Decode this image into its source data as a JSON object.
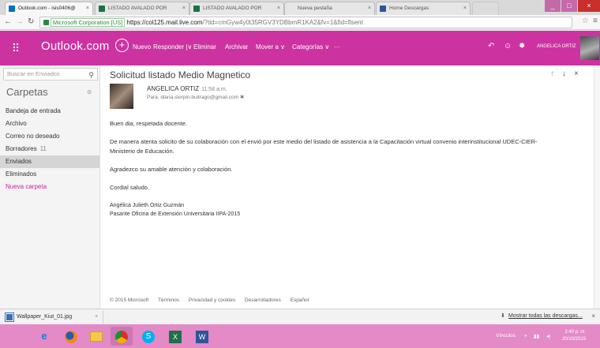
{
  "browser": {
    "tabs": [
      {
        "label": "Outlook.com - isis0406@",
        "color": "#0072c6"
      },
      {
        "label": "LISTADO AVALADO POR",
        "color": "#1e7145"
      },
      {
        "label": "LISTADO AVALADO POR",
        "color": "#1e7145"
      },
      {
        "label": "Nueva pestaña",
        "color": ""
      },
      {
        "label": "Home Descargas",
        "color": "#2b579a"
      }
    ],
    "tab_close": "×",
    "url_org": "Microsoft Corporation [US]",
    "url_host": "https://col125.mail.live.com",
    "url_path": "/?tid=cmGyw4y0t35RGV3YDBbmR1KA2&fv=1&fid=flsent",
    "win_min": "_",
    "win_max": "□",
    "win_close": "×"
  },
  "outlook": {
    "brand": "Outlook.com",
    "new_label": "Nuevo",
    "reply_label": "Responder |∨",
    "delete_label": "Eliminar",
    "archive_label": "Archivar",
    "move_label": "Mover a ∨",
    "categories_label": "Categorías ∨",
    "more_label": "···",
    "user_name": "ANGELICA ORTIZ",
    "accent": "#cc33a1"
  },
  "sidebar": {
    "search_placeholder": "Buscar en Enviados",
    "heading": "Carpetas",
    "folders": [
      {
        "label": "Bandeja de entrada",
        "count": ""
      },
      {
        "label": "Archivo",
        "count": ""
      },
      {
        "label": "Correo no deseado",
        "count": ""
      },
      {
        "label": "Borradores",
        "count": "11"
      },
      {
        "label": "Enviados",
        "count": ""
      },
      {
        "label": "Eliminados",
        "count": ""
      },
      {
        "label": "Nueva carpeta",
        "count": ""
      }
    ]
  },
  "message": {
    "subject": "Solicitud listado Medio Magnetico",
    "sender": "ANGELICA ORTIZ",
    "time": "11:58 a.m.",
    "to": "Para: diana.sterpin.buitrago@gmail.com ✖",
    "body": [
      "Buen dia, respetada docente.",
      "De manera atenta solicito de su colaboración con el envió por este medio del listado de asistencia a la Capacitación virtual convenio interinstitucional UDEC-CIER-",
      "Ministerio de Educación.",
      "Agradezco su amable atención y colaboración.",
      "Cordial saludo,",
      "Angélica Julieth Ortiz Guzmán",
      "Pasante Oficina de Extensión Universitaria IIPA-2015"
    ]
  },
  "footer": {
    "copyright": "© 2015 Microsoft",
    "links": [
      "Términos",
      "Privacidad y cookies",
      "Desarrolladores",
      "Español"
    ]
  },
  "downloads": {
    "file": "Wallpaper_Kiut_01.jpg",
    "show_all": "Mostrar todas las descargas...",
    "close": "×"
  },
  "taskbar": {
    "tray_label": "Vínculos",
    "time": "3:40 p. m.",
    "date": "20/10/2015"
  }
}
